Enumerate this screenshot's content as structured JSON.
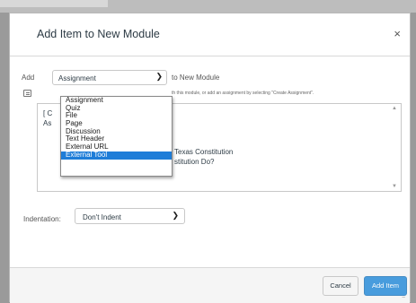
{
  "modal": {
    "title": "Add Item to New Module",
    "close": "×"
  },
  "add_row": {
    "label": "Add",
    "selected": "Assignment",
    "to_text": "to New Module",
    "help_text": "th this module, or add an assignment by selecting \"Create Assignment\"."
  },
  "dropdown": {
    "options": [
      "Assignment",
      "Quiz",
      "File",
      "Page",
      "Discussion",
      "Text Header",
      "External URL",
      "External Tool"
    ],
    "highlighted_index": 7
  },
  "list_box": {
    "fragments": [
      "[ C",
      "As",
      "Texas Constitution",
      "stitution Do?"
    ]
  },
  "indentation": {
    "label": "Indentation:",
    "value": "Don't Indent"
  },
  "footer": {
    "cancel": "Cancel",
    "add_item": "Add Item"
  },
  "colors": {
    "primary_button": "#0f7fd6",
    "dropdown_highlight": "#1e7dd8"
  }
}
